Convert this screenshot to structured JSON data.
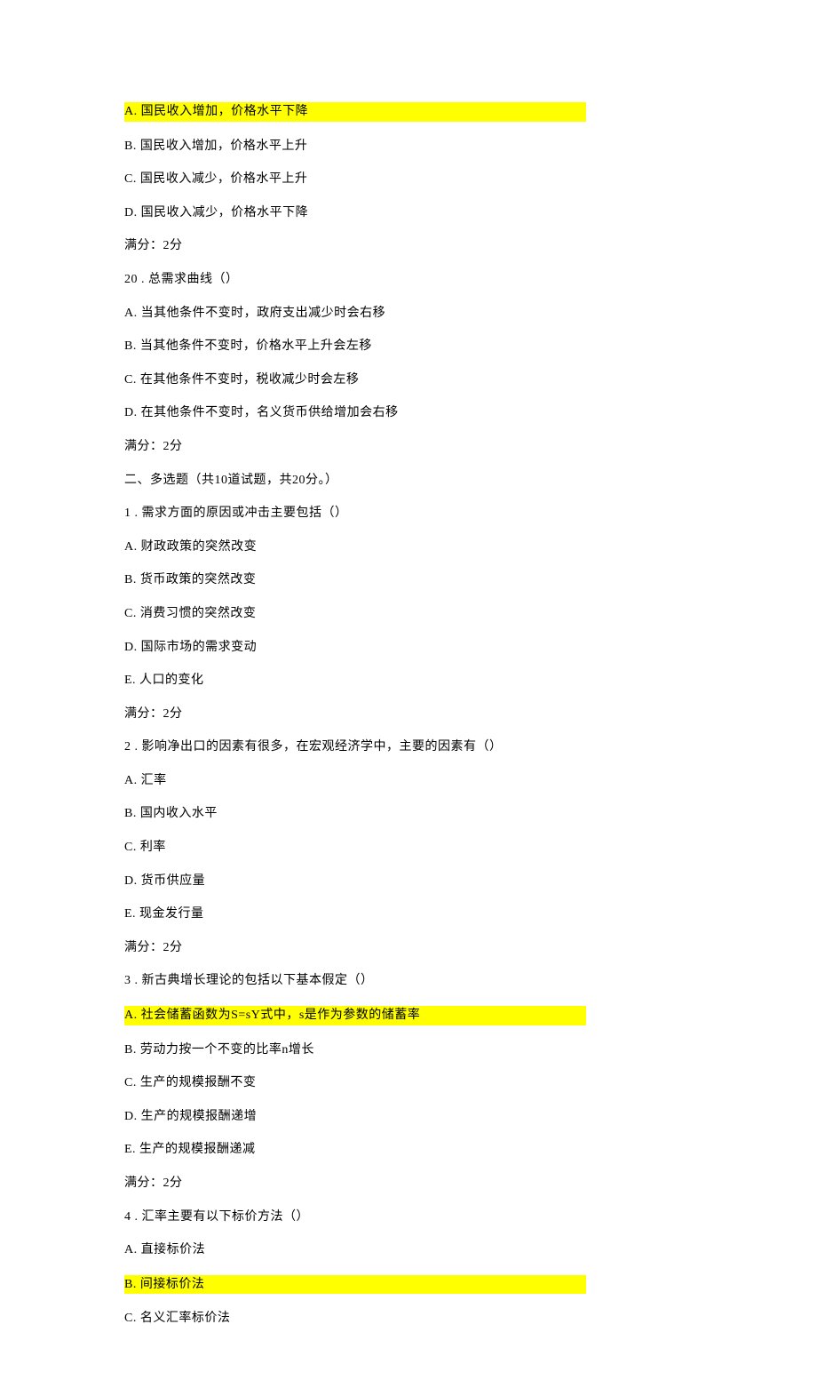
{
  "lines": [
    {
      "text": "A. 国民收入增加，价格水平下降",
      "highlight": true
    },
    {
      "text": "B. 国民收入增加，价格水平上升",
      "highlight": false
    },
    {
      "text": "C. 国民收入减少，价格水平上升",
      "highlight": false
    },
    {
      "text": "D. 国民收入减少，价格水平下降",
      "highlight": false
    },
    {
      "text": "满分：2分",
      "highlight": false
    },
    {
      "text": "20 . 总需求曲线（）",
      "highlight": false
    },
    {
      "text": "A. 当其他条件不变时，政府支出减少时会右移",
      "highlight": false
    },
    {
      "text": "B. 当其他条件不变时，价格水平上升会左移",
      "highlight": false
    },
    {
      "text": "C. 在其他条件不变时，税收减少时会左移",
      "highlight": false
    },
    {
      "text": "D. 在其他条件不变时，名义货币供给增加会右移",
      "highlight": false
    },
    {
      "text": "满分：2分",
      "highlight": false
    },
    {
      "text": "二、多选题（共10道试题，共20分。）",
      "highlight": false
    },
    {
      "text": "1 . 需求方面的原因或冲击主要包括（）",
      "highlight": false
    },
    {
      "text": "A. 财政政策的突然改变",
      "highlight": false
    },
    {
      "text": "B. 货币政策的突然改变",
      "highlight": false
    },
    {
      "text": "C. 消费习惯的突然改变",
      "highlight": false
    },
    {
      "text": "D. 国际市场的需求变动",
      "highlight": false
    },
    {
      "text": "E. 人口的变化",
      "highlight": false
    },
    {
      "text": "满分：2分",
      "highlight": false
    },
    {
      "text": "2 . 影响净出口的因素有很多，在宏观经济学中，主要的因素有（）",
      "highlight": false
    },
    {
      "text": "A. 汇率",
      "highlight": false
    },
    {
      "text": "B. 国内收入水平",
      "highlight": false
    },
    {
      "text": "C. 利率",
      "highlight": false
    },
    {
      "text": "D. 货币供应量",
      "highlight": false
    },
    {
      "text": "E. 现金发行量",
      "highlight": false
    },
    {
      "text": "满分：2分",
      "highlight": false
    },
    {
      "text": "3 . 新古典增长理论的包括以下基本假定（）",
      "highlight": false
    },
    {
      "text": "A. 社会储蓄函数为S=sY式中，s是作为参数的储蓄率",
      "highlight": true
    },
    {
      "text": "B. 劳动力按一个不变的比率n增长",
      "highlight": false
    },
    {
      "text": "C. 生产的规模报酬不变",
      "highlight": false
    },
    {
      "text": "D. 生产的规模报酬递增",
      "highlight": false
    },
    {
      "text": "E. 生产的规模报酬递减",
      "highlight": false
    },
    {
      "text": "满分：2分",
      "highlight": false
    },
    {
      "text": "4 . 汇率主要有以下标价方法（）",
      "highlight": false
    },
    {
      "text": "A. 直接标价法",
      "highlight": false
    },
    {
      "text": "B. 间接标价法",
      "highlight": true
    },
    {
      "text": "C. 名义汇率标价法",
      "highlight": false
    }
  ]
}
